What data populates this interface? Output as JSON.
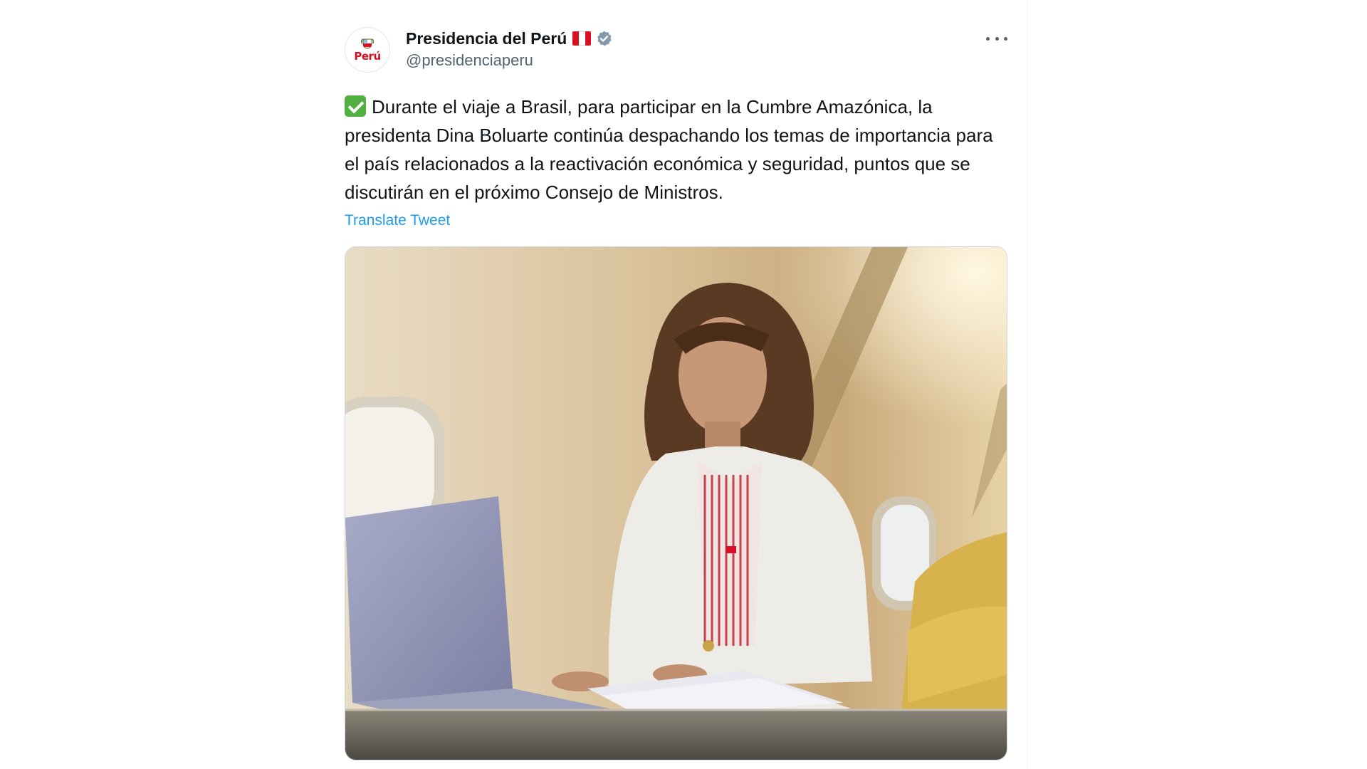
{
  "tweet": {
    "author": {
      "name": "Presidencia del Perú",
      "handle": "@presidenciaperu",
      "avatar_logo_text": "Perú",
      "flag_icon": "peru-flag-icon",
      "verified_icon": "verified-badge-icon"
    },
    "more_icon": "more-options-icon",
    "text": "Durante el viaje a Brasil, para participar en la Cumbre Amazónica, la presidenta Dina Boluarte continúa despachando los temas de importancia para el país relacionados a la reactivación económica y seguridad, puntos que se discutirán en el próximo Consejo de Ministros.",
    "text_icon": "check-mark-emoji-icon",
    "translate_label": "Translate Tweet",
    "photo": {
      "icon": "tweet-photo"
    }
  },
  "colors": {
    "text_primary": "#0f1419",
    "text_secondary": "#536471",
    "link": "#1d9bf0",
    "verified": "#829aab",
    "flag_red": "#d91023"
  }
}
